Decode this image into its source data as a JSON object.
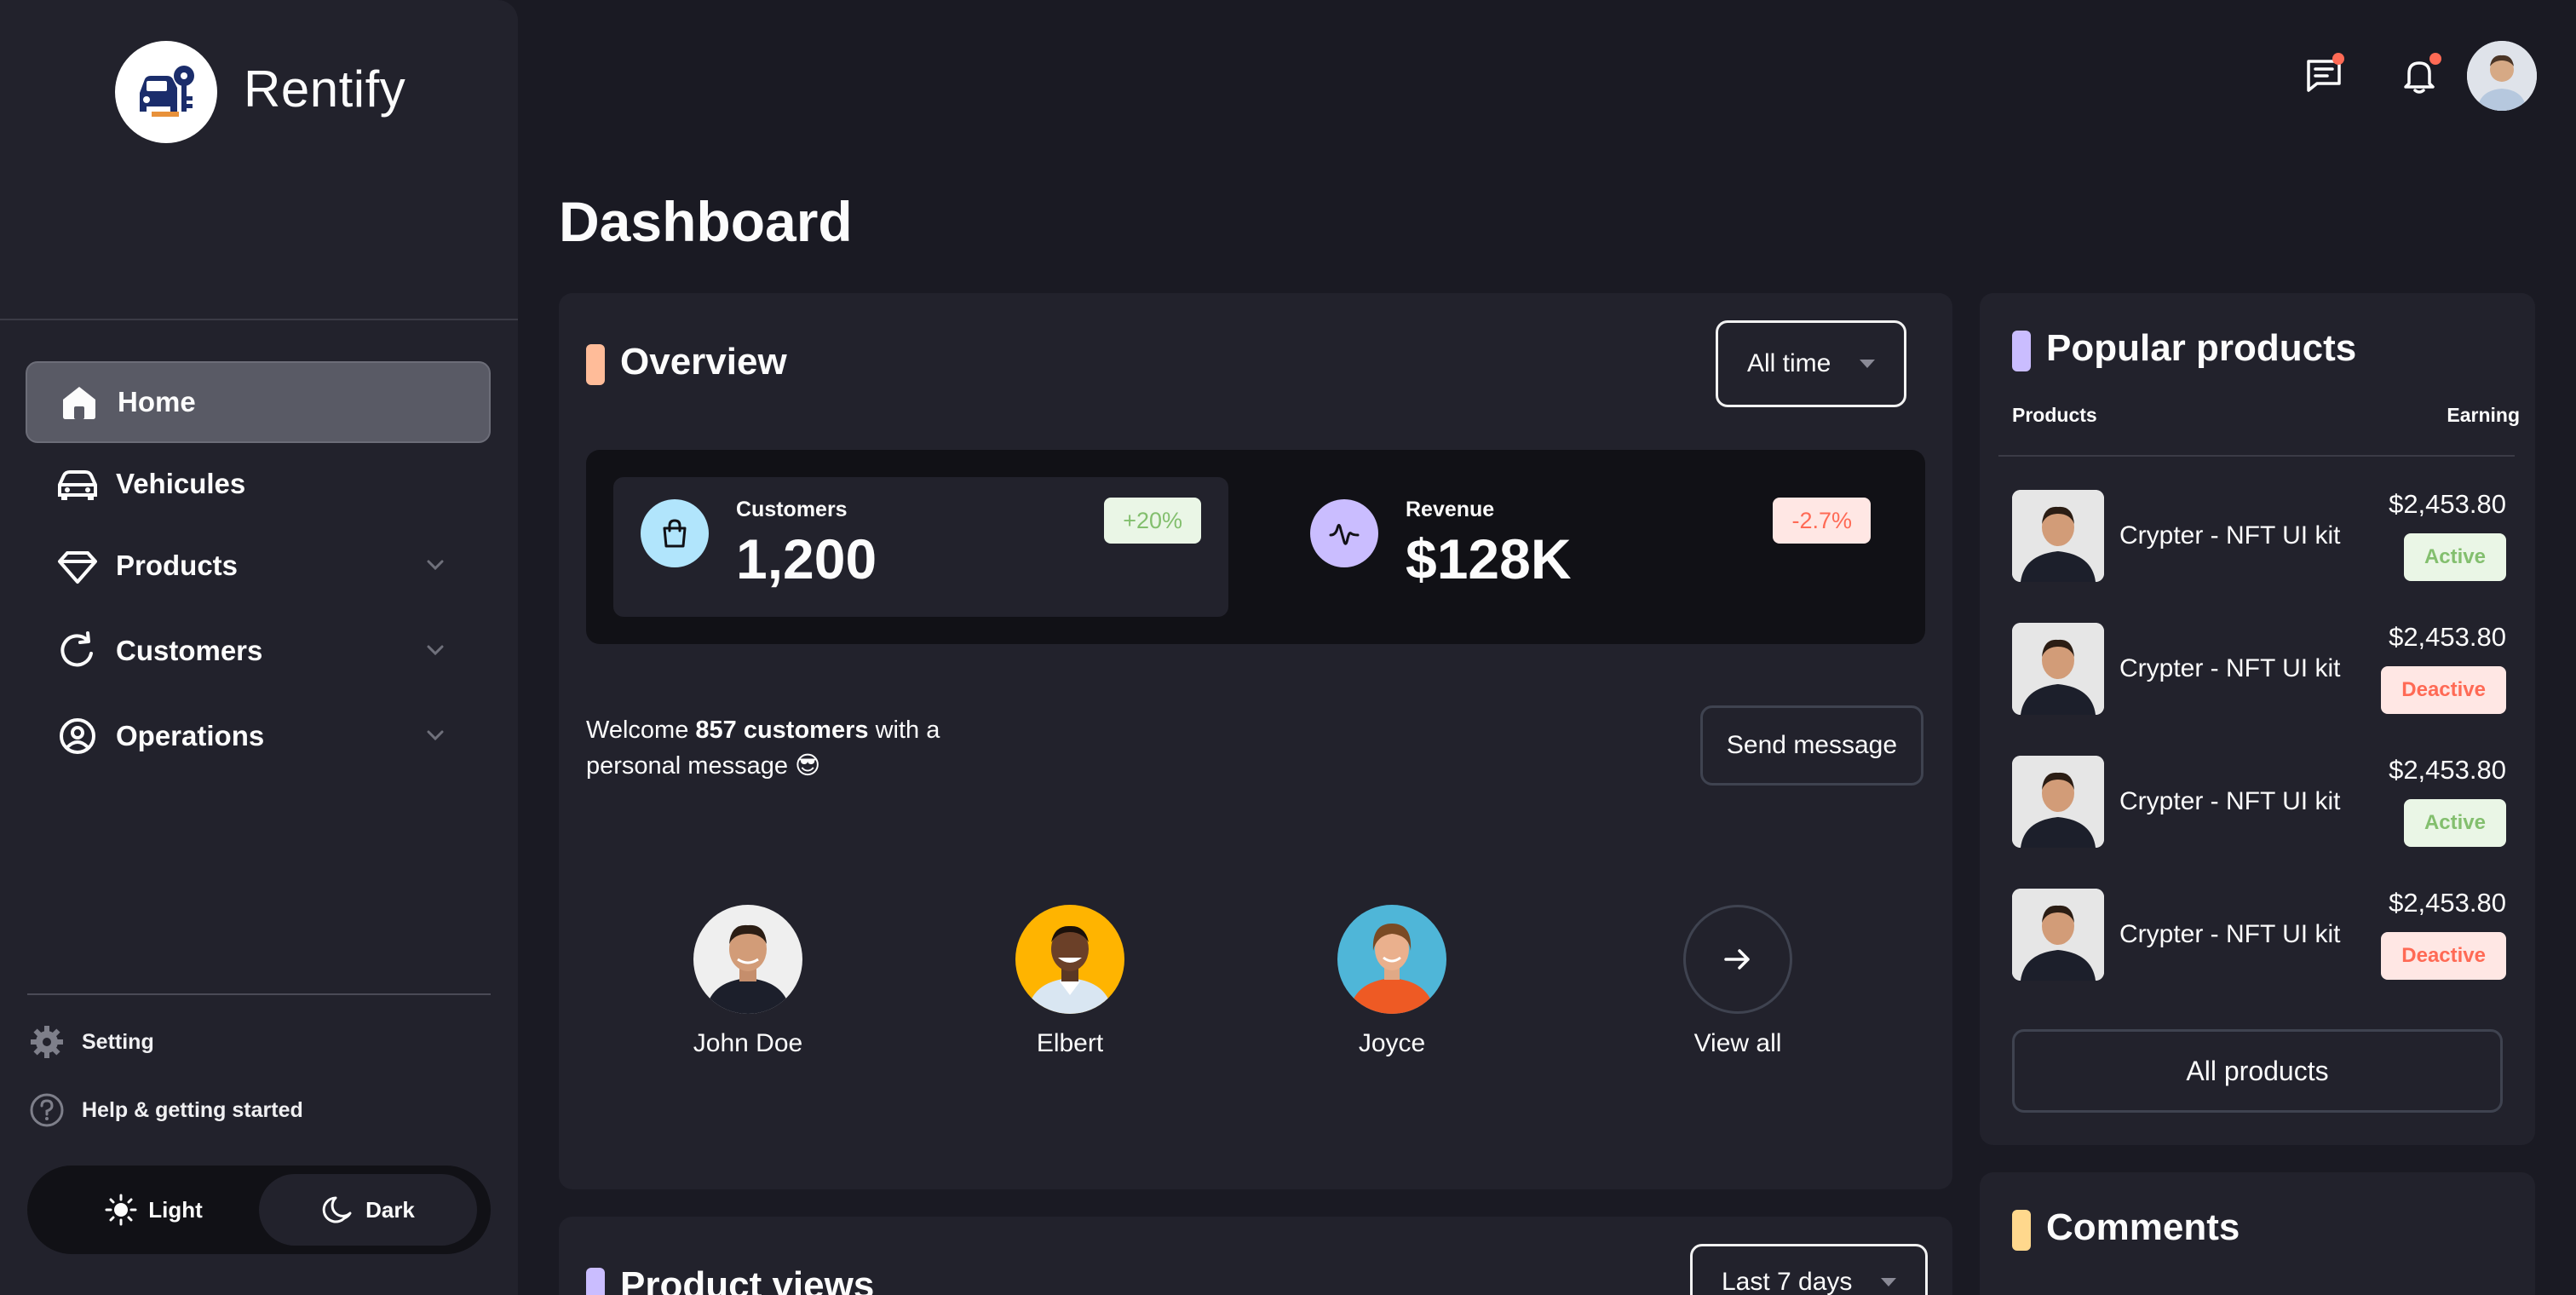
{
  "brand": {
    "name": "Rentify",
    "logo_icon": "car-key-logo"
  },
  "sidebar": {
    "items": [
      {
        "label": "Home",
        "icon": "home-icon",
        "active": true
      },
      {
        "label": "Vehicules",
        "icon": "car-icon"
      },
      {
        "label": "Products",
        "icon": "diamond-icon",
        "expandable": true
      },
      {
        "label": "Customers",
        "icon": "refresh-icon",
        "expandable": true
      },
      {
        "label": "Operations",
        "icon": "user-circle-icon",
        "expandable": true
      }
    ],
    "footer": [
      {
        "label": "Setting",
        "icon": "gear-icon"
      },
      {
        "label": "Help & getting started",
        "icon": "help-icon"
      }
    ],
    "theme": {
      "light_label": "Light",
      "dark_label": "Dark",
      "selected": "Dark"
    }
  },
  "header": {
    "icons": [
      "chat-icon",
      "bell-icon",
      "avatar"
    ]
  },
  "page": {
    "title": "Dashboard"
  },
  "overview": {
    "title": "Overview",
    "accent": "#ffbc99",
    "filter": "All time",
    "stats": [
      {
        "label": "Customers",
        "value": "1,200",
        "badge": "+20%",
        "trend": "up",
        "icon": "shopping-bag-icon",
        "icon_bg": "#b1e5fc"
      },
      {
        "label": "Revenue",
        "value": "$128K",
        "badge": "-2.7%",
        "trend": "down",
        "icon": "activity-icon",
        "icon_bg": "#cabdff"
      }
    ],
    "welcome_prefix": "Welcome ",
    "welcome_bold": "857 customers",
    "welcome_suffix": " with a personal message 😎",
    "send_button": "Send message",
    "customers": [
      {
        "name": "John Doe",
        "bg": "#efefef"
      },
      {
        "name": "Elbert",
        "bg": "#ffb400"
      },
      {
        "name": "Joyce",
        "bg": "#4fb6d8"
      }
    ],
    "view_all": "View all"
  },
  "product_views": {
    "title": "Product views",
    "accent": "#cabdff",
    "filter": "Last 7 days"
  },
  "popular": {
    "title": "Popular products",
    "accent": "#cabdff",
    "col_products": "Products",
    "col_earning": "Earning",
    "rows": [
      {
        "name": "Crypter - NFT UI kit",
        "price": "$2,453.80",
        "status": "Active"
      },
      {
        "name": "Crypter - NFT UI kit",
        "price": "$2,453.80",
        "status": "Deactive"
      },
      {
        "name": "Crypter - NFT UI kit",
        "price": "$2,453.80",
        "status": "Active"
      },
      {
        "name": "Crypter - NFT UI kit",
        "price": "$2,453.80",
        "status": "Deactive"
      }
    ],
    "all_button": "All products"
  },
  "comments": {
    "title": "Comments",
    "accent": "#ffd88d"
  },
  "colors": {
    "bg": "#1a1a23",
    "panel": "#22222c",
    "active_green": "#83bf6e",
    "deactive_red": "#ff6a55"
  }
}
